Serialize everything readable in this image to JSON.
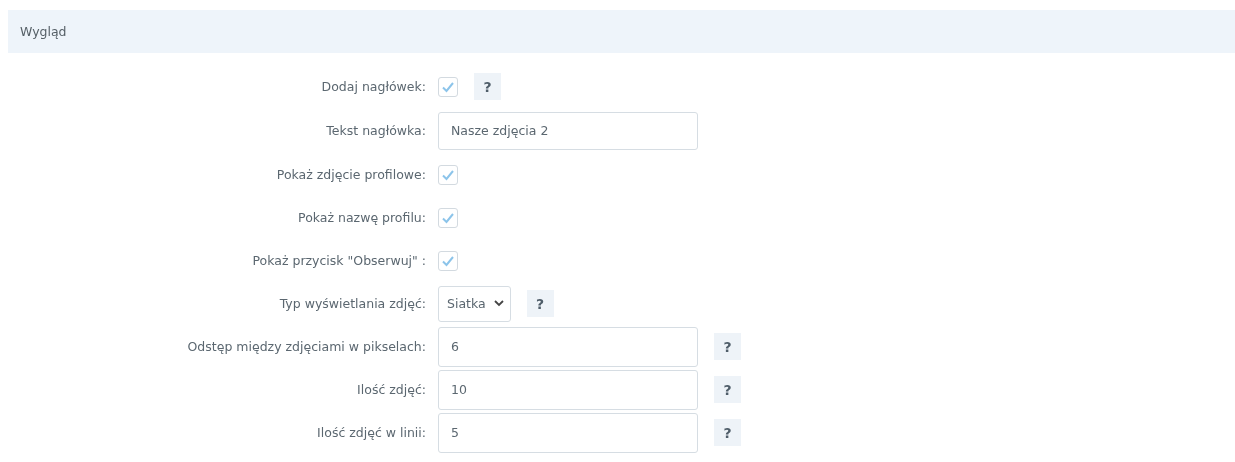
{
  "section": {
    "title": "Wygląd"
  },
  "rows": [
    {
      "kind": "checkbox",
      "label": "Dodaj nagłówek:",
      "checked": true,
      "help": "?"
    },
    {
      "kind": "text",
      "label": "Tekst nagłówka:",
      "value": "Nasze zdjęcia 2"
    },
    {
      "kind": "checkbox",
      "label": "Pokaż zdjęcie profilowe:",
      "checked": true
    },
    {
      "kind": "checkbox",
      "label": "Pokaż nazwę profilu:",
      "checked": true
    },
    {
      "kind": "checkbox",
      "label": "Pokaż przycisk \"Obserwuj\" :",
      "checked": true
    },
    {
      "kind": "select",
      "label": "Typ wyświetlania zdjęć:",
      "value": "Siatka",
      "help": "?"
    },
    {
      "kind": "number",
      "label": "Odstęp między zdjęciami w pikselach:",
      "value": "6",
      "help": "?"
    },
    {
      "kind": "number",
      "label": "Ilość zdjęć:",
      "value": "10",
      "help": "?"
    },
    {
      "kind": "number",
      "label": "Ilość zdjęć w linii:",
      "value": "5",
      "help": "?"
    }
  ]
}
